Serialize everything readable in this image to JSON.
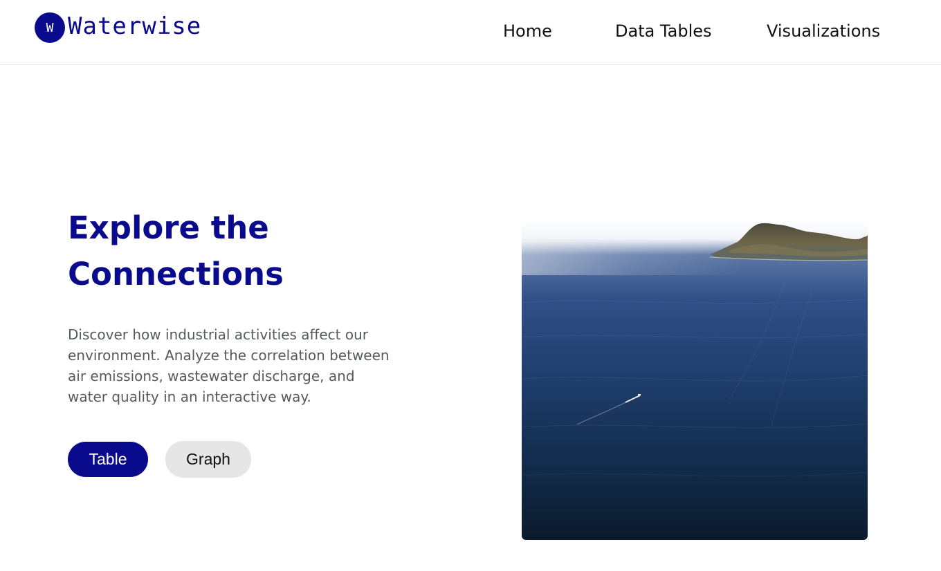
{
  "brand": {
    "logo_letter": "W",
    "name": "Waterwise"
  },
  "nav": {
    "home": "Home",
    "data_tables": "Data Tables",
    "visualizations": "Visualizations"
  },
  "hero": {
    "title": "Explore the Connections",
    "description": "Discover how industrial activities affect our environment. Analyze the correlation between air emissions, wastewater discharge, and water quality in an interactive way.",
    "buttons": {
      "table": "Table",
      "graph": "Graph"
    },
    "image": "ocean-with-island-and-boat"
  },
  "colors": {
    "primary": "#0a0a8c",
    "text_muted": "#555a5f",
    "button_secondary": "#e6e6e6"
  }
}
